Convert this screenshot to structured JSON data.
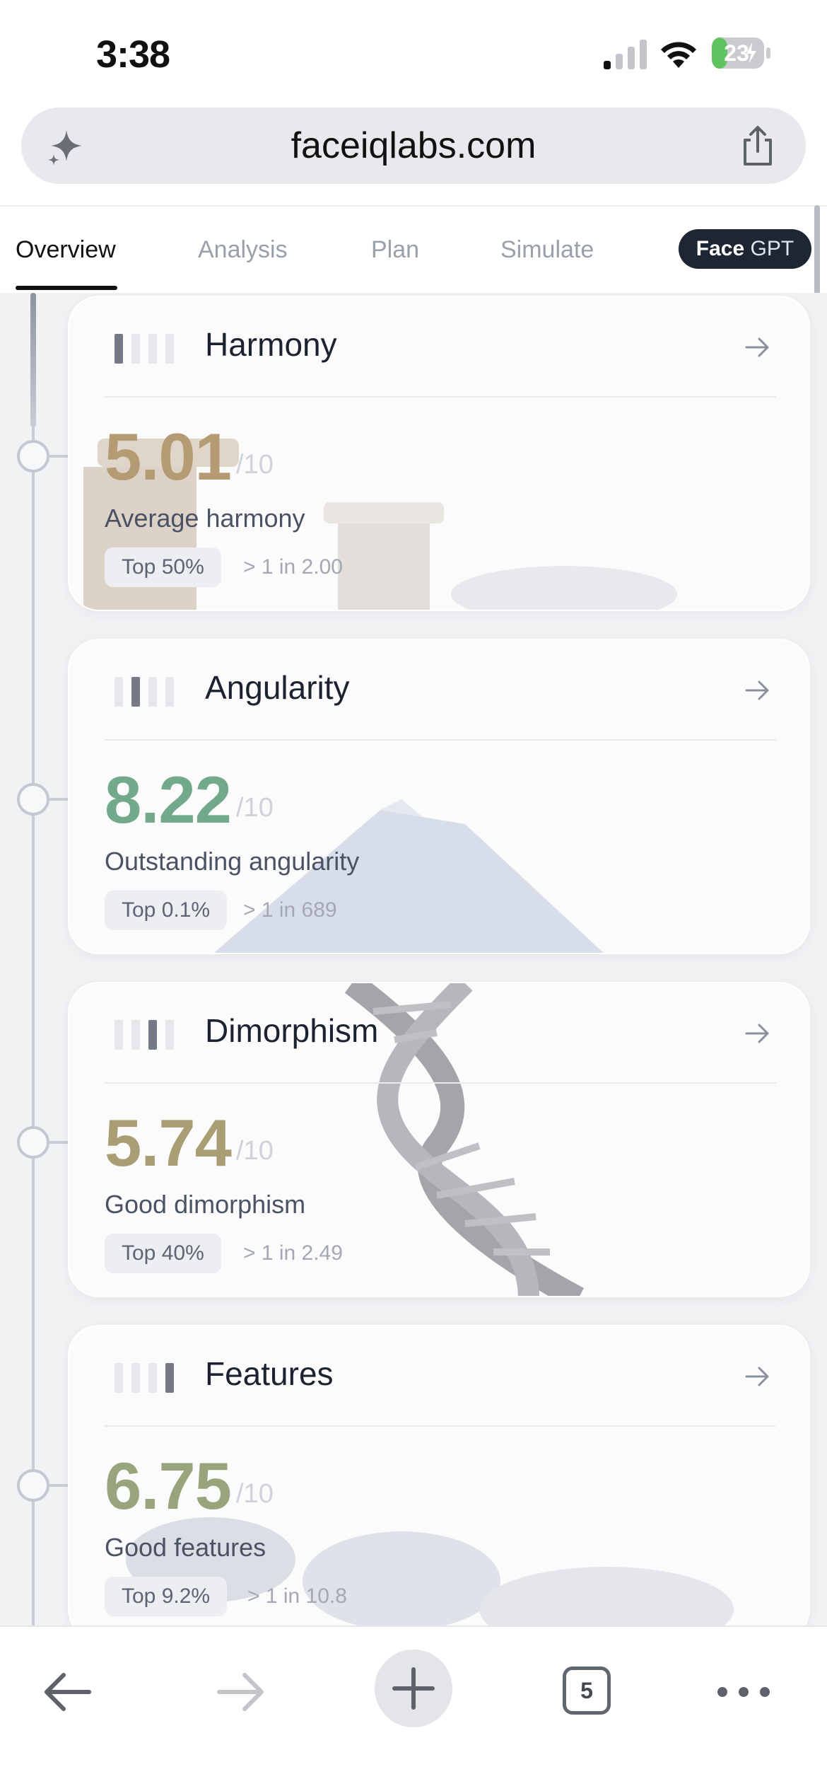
{
  "status": {
    "time": "3:38",
    "battery": "23",
    "battery_color": "#5fc35f"
  },
  "browser": {
    "url": "faceiqlabs.com",
    "tabs_count": "5"
  },
  "nav_tabs": [
    {
      "label": "Overview",
      "active": true
    },
    {
      "label": "Analysis",
      "active": false
    },
    {
      "label": "Plan",
      "active": false
    },
    {
      "label": "Simulate",
      "active": false
    }
  ],
  "facegpt": {
    "bold": "Face",
    "light": "GPT"
  },
  "cards": [
    {
      "title": "Harmony",
      "score": "5.01",
      "score_suffix": "/10",
      "score_color": "#b49b73",
      "description": "Average harmony",
      "rank": "Top 50%",
      "odds": "> 1 in 2.00",
      "icon_active_bar": 1,
      "icon": "bars-level-icon"
    },
    {
      "title": "Angularity",
      "score": "8.22",
      "score_suffix": "/10",
      "score_color": "#72a98a",
      "description": "Outstanding angularity",
      "rank": "Top 0.1%",
      "odds": "> 1 in 689",
      "icon_active_bar": 2,
      "icon": "bars-level-icon"
    },
    {
      "title": "Dimorphism",
      "score": "5.74",
      "score_suffix": "/10",
      "score_color": "#a89d73",
      "description": "Good dimorphism",
      "rank": "Top 40%",
      "odds": "> 1 in 2.49",
      "icon_active_bar": 3,
      "icon": "bars-level-icon"
    },
    {
      "title": "Features",
      "score": "6.75",
      "score_suffix": "/10",
      "score_color": "#98a47c",
      "description": "Good features",
      "rank": "Top 9.2%",
      "odds": "> 1 in 10.8",
      "icon_active_bar": 4,
      "icon": "bars-level-icon"
    }
  ]
}
